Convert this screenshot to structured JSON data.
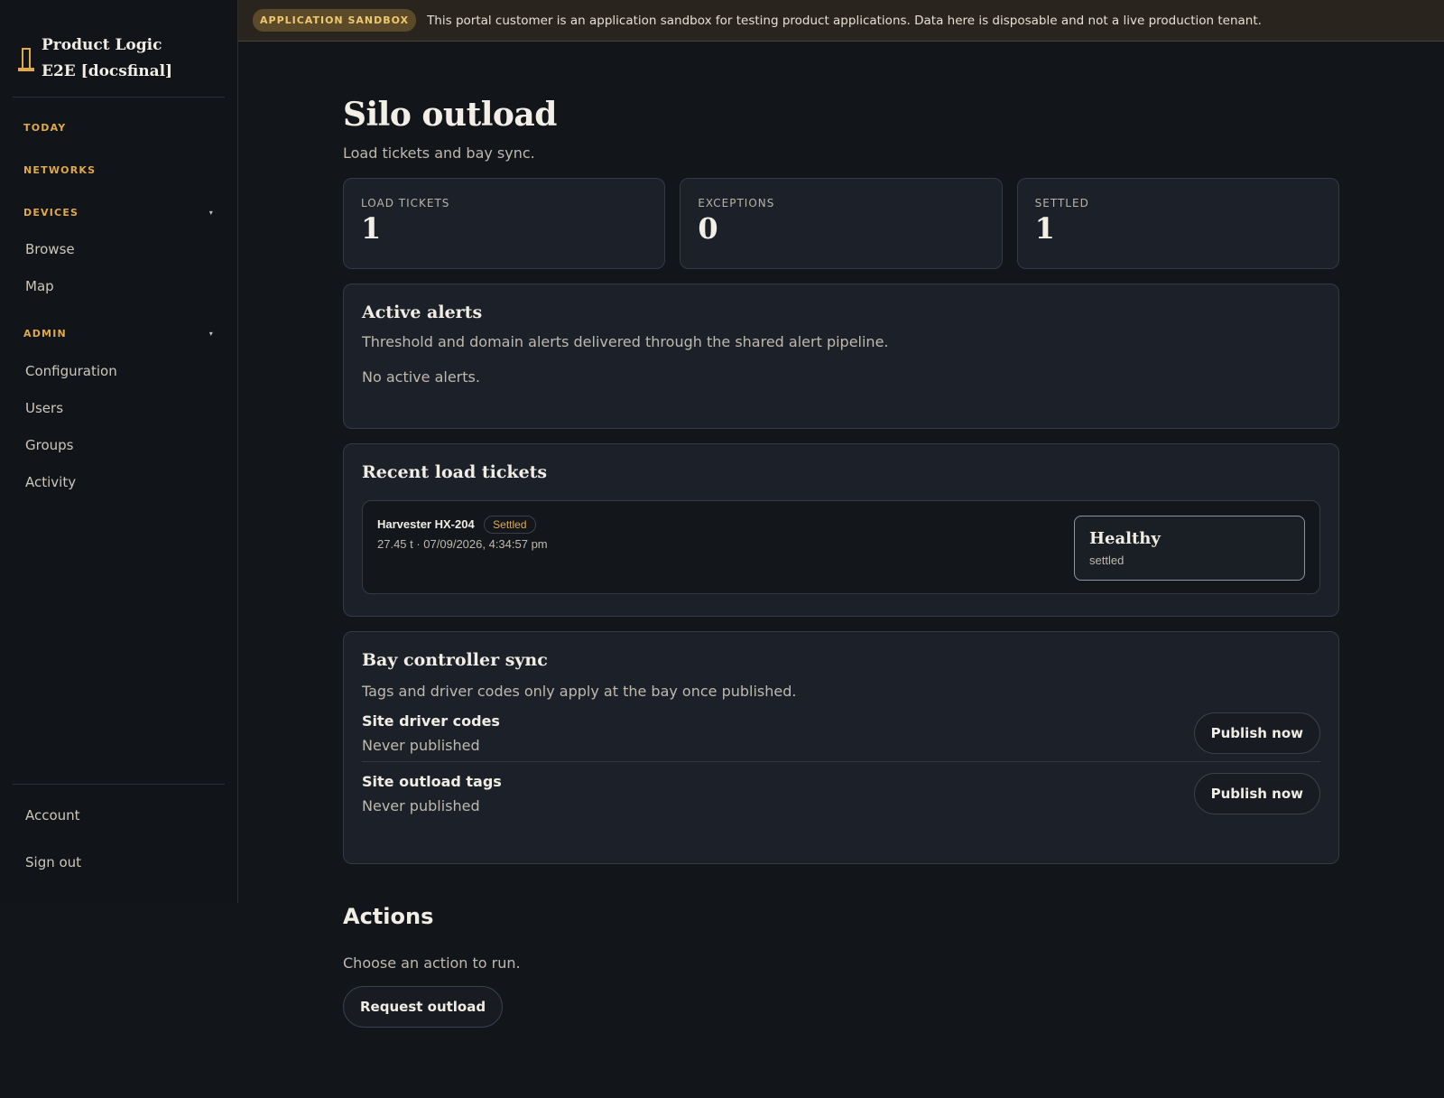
{
  "sidebar": {
    "brand": "Product Logic E2E [docsfinal]",
    "sections": {
      "today": "TODAY",
      "networks": "NETWORKS",
      "devices": "DEVICES",
      "admin": "ADMIN"
    },
    "caret": "▾",
    "device_items": [
      "Browse",
      "Map"
    ],
    "admin_items": [
      "Configuration",
      "Users",
      "Groups",
      "Activity"
    ],
    "footer_items": [
      "Account",
      "Sign out"
    ]
  },
  "banner": {
    "badge": "APPLICATION SANDBOX",
    "text": "This portal customer is an application sandbox for testing product applications. Data here is disposable and not a live production tenant."
  },
  "page": {
    "title": "Silo outload",
    "subtitle": "Load tickets and bay sync."
  },
  "stats": [
    {
      "label": "LOAD TICKETS",
      "value": "1"
    },
    {
      "label": "EXCEPTIONS",
      "value": "0"
    },
    {
      "label": "SETTLED",
      "value": "1"
    }
  ],
  "alerts": {
    "title": "Active alerts",
    "subtitle": "Threshold and domain alerts delivered through the shared alert pipeline.",
    "empty": "No active alerts."
  },
  "tickets": {
    "title": "Recent load tickets",
    "items": [
      {
        "name": "Harvester HX-204",
        "badge": "Settled",
        "meta": "27.45 t · 07/09/2026, 4:34:57 pm",
        "health_title": "Healthy",
        "health_sub": "settled"
      }
    ]
  },
  "sync": {
    "title": "Bay controller sync",
    "subtitle": "Tags and driver codes only apply at the bay once published.",
    "rows": [
      {
        "name": "Site driver codes",
        "status": "Never published",
        "button": "Publish now"
      },
      {
        "name": "Site outload tags",
        "status": "Never published",
        "button": "Publish now"
      }
    ]
  },
  "actions": {
    "title": "Actions",
    "subtitle": "Choose an action to run.",
    "button": "Request outload"
  },
  "colors": {
    "accent": "#e0a94a",
    "background": "#12161b",
    "card": "#1c2129"
  }
}
